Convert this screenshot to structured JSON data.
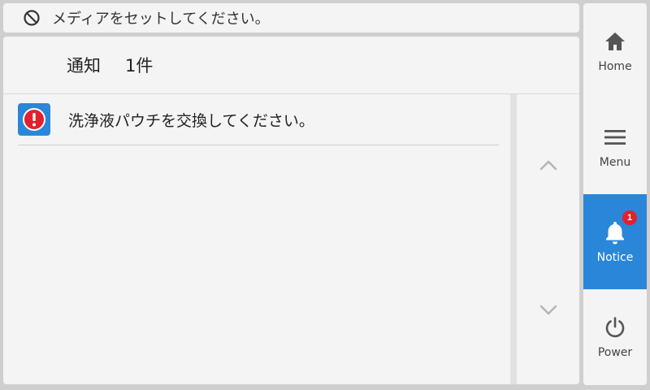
{
  "status_bar": {
    "icon": "no-media-icon",
    "message": "メディアをセットしてください。"
  },
  "panel": {
    "title": "通知",
    "count": "1件"
  },
  "notices": [
    {
      "icon": "error-exclamation-icon",
      "text": "洗浄液パウチを交換してください。"
    }
  ],
  "scroll": {
    "up_icon": "chevron-up-icon",
    "down_icon": "chevron-down-icon"
  },
  "nav": {
    "home": {
      "label": "Home",
      "icon": "home-icon"
    },
    "menu": {
      "label": "Menu",
      "icon": "hamburger-menu-icon"
    },
    "notice": {
      "label": "Notice",
      "icon": "bell-icon",
      "badge": "1"
    },
    "power": {
      "label": "Power",
      "icon": "power-icon"
    }
  },
  "colors": {
    "accent": "#2a86d8",
    "badge": "#e3202b",
    "panel_bg": "#f4f4f4",
    "frame_bg": "#cfcfcf"
  }
}
